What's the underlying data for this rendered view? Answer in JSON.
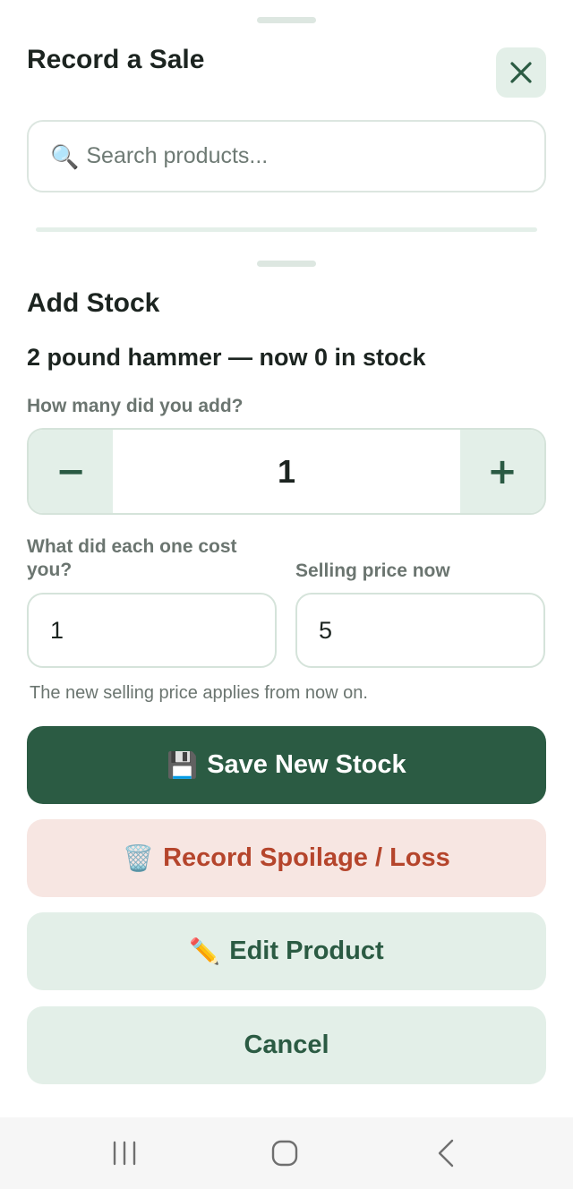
{
  "sale_sheet": {
    "title": "Record a Sale",
    "search": {
      "placeholder": "Search products...",
      "icon": "search-icon"
    },
    "close_icon": "close-icon"
  },
  "stock_sheet": {
    "title": "Add Stock",
    "product_line": "2 pound hammer — now 0 in stock",
    "quantity": {
      "label": "How many did you add?",
      "value": "1",
      "minus_label": "−",
      "plus_label": "+"
    },
    "cost": {
      "label": "What did each one cost you?",
      "value": "1"
    },
    "price": {
      "label": "Selling price now",
      "value": "5"
    },
    "hint": "The new selling price applies from now on.",
    "buttons": {
      "save": {
        "emoji": "💾",
        "label": "Save New Stock"
      },
      "spoilage": {
        "emoji": "🗑️",
        "label": "Record Spoilage / Loss"
      },
      "edit": {
        "emoji": "✏️",
        "label": "Edit Product"
      },
      "cancel": {
        "label": "Cancel"
      }
    }
  },
  "colors": {
    "primary": "#2b5b43",
    "primary_soft": "#e3efe8",
    "danger": "#b5452c",
    "danger_soft": "#f7e6e2",
    "muted_text": "#6b7570"
  },
  "system_nav": [
    "recent-apps-icon",
    "home-icon",
    "back-icon"
  ]
}
